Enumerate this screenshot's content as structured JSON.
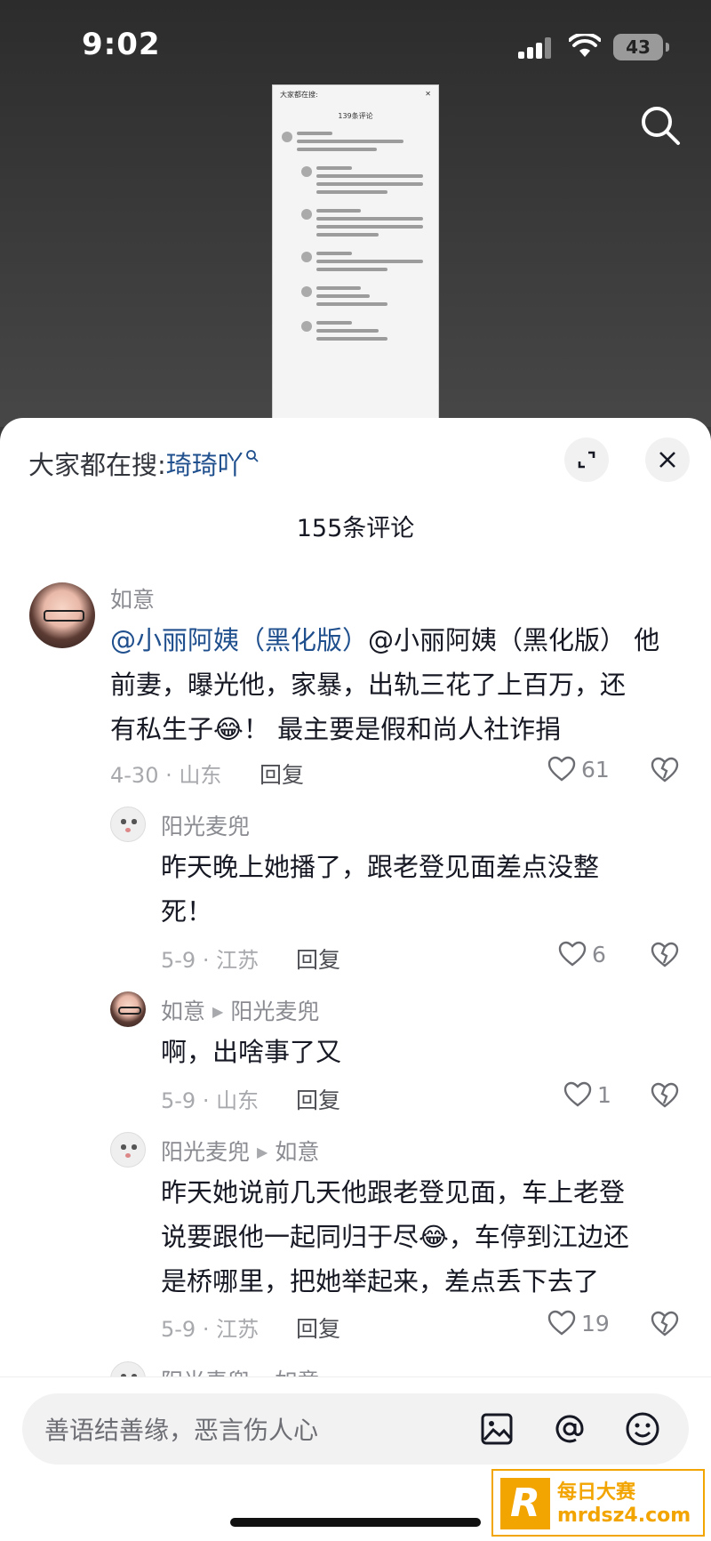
{
  "status_bar": {
    "time": "9:02",
    "battery": "43"
  },
  "thumbnail": {
    "header_prefix": "大家都在搜:",
    "count": "139条评论"
  },
  "sheet": {
    "hot_search_prefix": "大家都在搜:",
    "hot_search_keyword": "琦琦吖",
    "comment_count_title": "155条评论"
  },
  "comments": [
    {
      "user": "如意",
      "mention": "@小丽阿姨（黑化版）",
      "line1_rest": "@小丽阿姨（黑化版） 他",
      "line2": "前妻，曝光他，家暴，出轨三花了上百万，还",
      "line3a": "有私生子",
      "line3b": "！ 最主要是假和尚人社诈捐",
      "date_loc": "4-30 · 山东",
      "reply": "回复",
      "likes": "61"
    },
    {
      "user": "阳光麦兜",
      "line1": "昨天晚上她播了，跟老登见面差点没整",
      "line2": "死！",
      "date_loc": "5-9 · 江苏",
      "reply": "回复",
      "likes": "6"
    },
    {
      "user": "如意",
      "reply_to": "阳光麦兜",
      "line1": "啊，出啥事了又",
      "date_loc": "5-9 · 山东",
      "reply": "回复",
      "likes": "1"
    },
    {
      "user": "阳光麦兜",
      "reply_to": "如意",
      "line1": "昨天她说前几天他跟老登见面，车上老登",
      "line2a": "说要跟他一起同归于尽",
      "line2b": "，车停到江边还",
      "line3": "是桥哪里，把她举起来，差点丢下去了",
      "date_loc": "5-9 · 江苏",
      "reply": "回复",
      "likes": "19"
    },
    {
      "user": "阳光麦兜",
      "reply_to": "如意"
    }
  ],
  "input": {
    "placeholder": "善语结善缘，恶言伤人心"
  },
  "watermark": {
    "logo": "R",
    "line1": "每日大赛",
    "line2": "mrdsz4.com"
  },
  "icons": [
    "search-icon",
    "expand-icon",
    "close-icon",
    "heart-icon",
    "broken-heart-icon",
    "image-icon",
    "at-icon",
    "emoji-icon",
    "laughing-crying-emoji"
  ]
}
